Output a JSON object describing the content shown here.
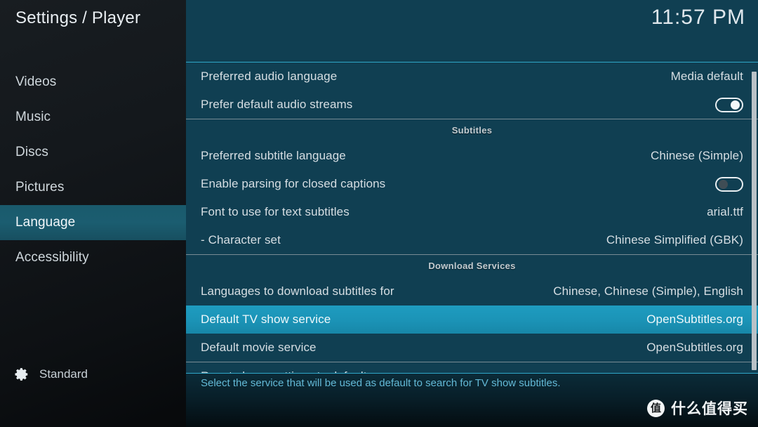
{
  "header": {
    "title": "Settings / Player",
    "clock": "11:57 PM"
  },
  "sidebar": {
    "items": [
      {
        "label": "Videos",
        "selected": false
      },
      {
        "label": "Music",
        "selected": false
      },
      {
        "label": "Discs",
        "selected": false
      },
      {
        "label": "Pictures",
        "selected": false
      },
      {
        "label": "Language",
        "selected": true
      },
      {
        "label": "Accessibility",
        "selected": false
      }
    ],
    "profile": {
      "label": "Standard",
      "icon": "gear-icon"
    }
  },
  "settings": {
    "rows": [
      {
        "kind": "setting",
        "label": "Preferred audio language",
        "value": "Media default",
        "selected": false
      },
      {
        "kind": "toggle",
        "label": "Prefer default audio streams",
        "toggle": "on",
        "selected": false
      },
      {
        "kind": "group",
        "label": "Subtitles"
      },
      {
        "kind": "setting",
        "label": "Preferred subtitle language",
        "value": "Chinese (Simple)",
        "selected": false
      },
      {
        "kind": "toggle",
        "label": "Enable parsing for closed captions",
        "toggle": "off",
        "selected": false
      },
      {
        "kind": "setting",
        "label": "Font to use for text subtitles",
        "value": "arial.ttf",
        "selected": false
      },
      {
        "kind": "setting",
        "label": "- Character set",
        "value": "Chinese Simplified (GBK)",
        "selected": false
      },
      {
        "kind": "group",
        "label": "Download Services"
      },
      {
        "kind": "setting",
        "label": "Languages to download subtitles for",
        "value": "Chinese, Chinese (Simple), English",
        "selected": false
      },
      {
        "kind": "setting",
        "label": "Default TV show service",
        "value": "OpenSubtitles.org",
        "selected": true
      },
      {
        "kind": "setting",
        "label": "Default movie service",
        "value": "OpenSubtitles.org",
        "selected": false
      },
      {
        "kind": "group",
        "label": ""
      },
      {
        "kind": "setting",
        "label": "Reset above settings to default",
        "value": "",
        "selected": false
      }
    ]
  },
  "footer": {
    "help_text": "Select the service that will be used as default to search for TV show subtitles."
  },
  "watermark": {
    "badge": "值",
    "text": "什么值得买"
  },
  "colors": {
    "sidebar_bg": "#14181c",
    "sidebar_selected": "#1b5d70",
    "panel_bg": "#103f52",
    "row_selected": "#1b93b6",
    "accent_rule": "#2fa6c8",
    "help_text": "#63b9d6",
    "text_primary": "#d6dee3"
  }
}
